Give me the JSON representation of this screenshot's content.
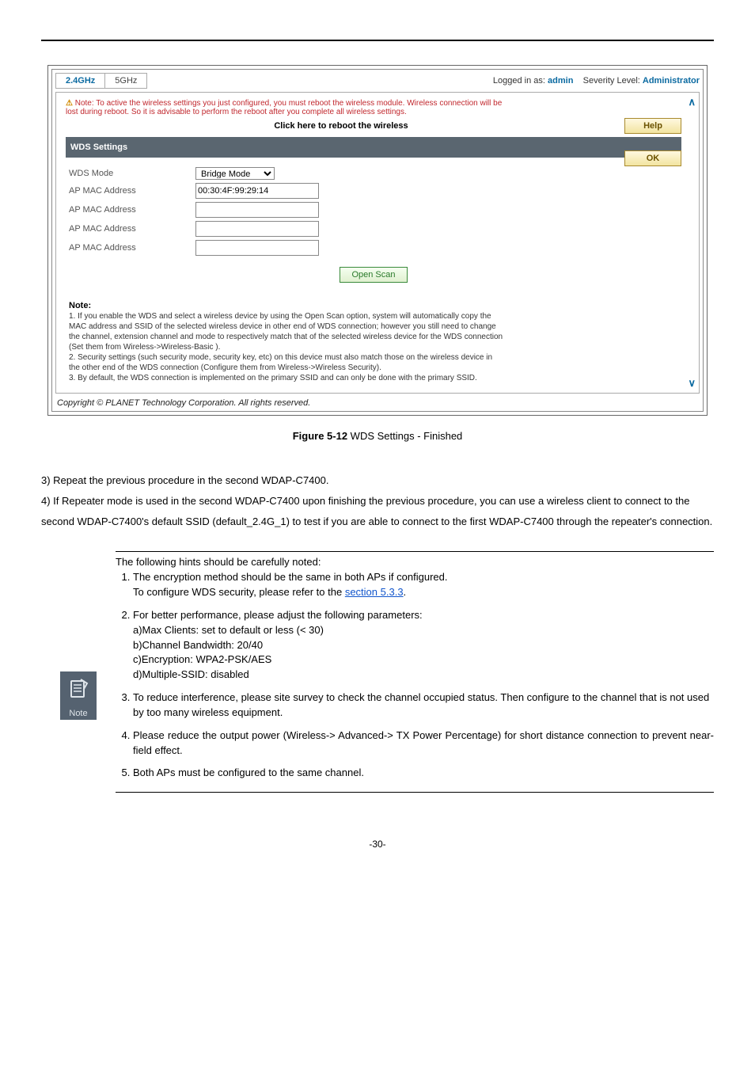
{
  "screenshot": {
    "tabs": {
      "active": "2.4GHz",
      "inactive": "5GHz"
    },
    "loginPrefix": "Logged in as: ",
    "loginUser": "admin",
    "severityPrefix": "Severity Level: ",
    "severityValue": "Administrator",
    "rebootWarningLine1": "Note: To active the wireless settings you just configured, you must reboot the wireless module. Wireless connection will be",
    "rebootWarningLine2": "lost during reboot. So it is advisable to perform the reboot after you complete all wireless settings.",
    "clickReboot": "Click here to reboot the wireless",
    "helpBtn": "Help",
    "okBtn": "OK",
    "sectionHeader": "WDS Settings",
    "form": {
      "wdsModeLabel": "WDS Mode",
      "wdsModeValue": "Bridge Mode",
      "apMacLabel": "AP MAC Address",
      "apMacValue1": "00:30:4F:99:29:14",
      "apMacValue2": "",
      "apMacValue3": "",
      "apMacValue4": ""
    },
    "scanBtn": "Open Scan",
    "note": {
      "title": "Note:",
      "n1a": "1. If you enable the WDS and select a wireless device by using the Open Scan option, system will automatically copy the",
      "n1b": "MAC address and SSID of the selected wireless device in other end of WDS connection; however you still need to change",
      "n1c": "the channel, extension channel and mode to respectively match that of the selected wireless device for the WDS connection",
      "n1d": "(Set them from Wireless->Wireless-Basic ).",
      "n2a": "2. Security settings (such security mode, security key, etc) on this device must also match those on the wireless device in",
      "n2b": "the other end of the WDS connection (Configure them from Wireless->Wireless Security).",
      "n3": "3. By default, the WDS connection is implemented on the primary SSID and can only be done with the primary SSID."
    },
    "copyright": "Copyright © PLANET Technology Corporation. All rights reserved."
  },
  "figureCaption": {
    "bold": "Figure 5-12",
    "rest": " WDS Settings - Finished"
  },
  "body": {
    "p3": "3) Repeat the previous procedure in the second WDAP-C7400.",
    "p4": "4) If Repeater mode is used in the second WDAP-C7400 upon finishing the previous procedure, you can use a wireless client to connect to the second WDAP-C7400's default SSID (default_2.4G_1) to test if you are able to connect to the first WDAP-C7400 through the repeater's connection."
  },
  "hints": {
    "intro": "The following hints should be carefully noted:",
    "h1a": "The encryption method should be the same in both APs if configured.",
    "h1b_pre": "To configure WDS security, please refer to the ",
    "h1b_link": "section 5.3.3",
    "h1b_post": ".",
    "h2_intro": "For better performance, please adjust the following parameters:",
    "h2a": "a)Max Clients: set to default or less (< 30)",
    "h2b": "b)Channel Bandwidth: 20/40",
    "h2c": "c)Encryption: WPA2-PSK/AES",
    "h2d": "d)Multiple-SSID: disabled",
    "h3": "To reduce interference, please site survey to check the channel occupied status. Then configure to the channel that is not used by too many wireless equipment.",
    "h4": "Please reduce the output power (Wireless-> Advanced-> TX Power Percentage) for short distance connection to prevent near-field effect.",
    "h5": "Both APs must be configured to the same channel.",
    "iconLabel": "Note"
  },
  "pageNum": "-30-",
  "chart_data": {
    "type": "table",
    "title": "WDS Settings form values",
    "data": [
      {
        "field": "WDS Mode",
        "value": "Bridge Mode"
      },
      {
        "field": "AP MAC Address",
        "value": "00:30:4F:99:29:14"
      },
      {
        "field": "AP MAC Address",
        "value": ""
      },
      {
        "field": "AP MAC Address",
        "value": ""
      },
      {
        "field": "AP MAC Address",
        "value": ""
      }
    ]
  }
}
